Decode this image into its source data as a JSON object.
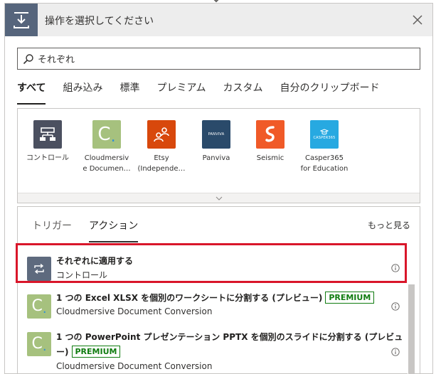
{
  "header": {
    "title": "操作を選択してください"
  },
  "search": {
    "value": "それぞれ"
  },
  "tabs": [
    {
      "label": "すべて",
      "active": true
    },
    {
      "label": "組み込み"
    },
    {
      "label": "標準"
    },
    {
      "label": "プレミアム"
    },
    {
      "label": "カスタム"
    },
    {
      "label": "自分のクリップボード"
    }
  ],
  "connectors": [
    {
      "label": "コントロール",
      "icon": "control-icon",
      "color": "#4b5060"
    },
    {
      "label": "Cloudmersive Documen…",
      "label_lines": [
        "Cloudmersiv",
        "e Documen…"
      ],
      "icon": "cloudmersive-icon",
      "color": "#a6c17e"
    },
    {
      "label": "Etsy (Independe…",
      "label_lines": [
        "Etsy",
        "(Independe…"
      ],
      "icon": "etsy-icon",
      "color": "#d8480c"
    },
    {
      "label": "Panviva",
      "icon": "panviva-icon",
      "color": "#2a4a6a",
      "tile_text": "PANVIVA"
    },
    {
      "label": "Seismic",
      "icon": "seismic-icon",
      "color": "#f05a28"
    },
    {
      "label": "Casper365 for Education",
      "label_lines": [
        "Casper365",
        "for Education"
      ],
      "icon": "casper-icon",
      "color": "#27a9e1",
      "tile_text": "CASPER365"
    }
  ],
  "subtabs": [
    {
      "label": "トリガー"
    },
    {
      "label": "アクション",
      "active": true
    }
  ],
  "see_more": "もっと見る",
  "actions": [
    {
      "title": "それぞれに適用する",
      "subtitle": "コントロール",
      "icon": "loop-icon",
      "color": "#5e6a7e"
    },
    {
      "title": "1 つの Excel XLSX を個別のワークシートに分割する (プレビュー)",
      "premium": "PREMIUM",
      "subtitle": "Cloudmersive Document Conversion",
      "icon": "cloudmersive-icon",
      "color": "#a6c17e"
    },
    {
      "title_line1": "1 つの PowerPoint プレゼンテーション PPTX を個別のスライドに分割する (プレビュ",
      "title_line2": "ー)",
      "premium": "PREMIUM",
      "subtitle": "Cloudmersive Document Conversion",
      "icon": "cloudmersive-icon",
      "color": "#a6c17e"
    }
  ],
  "colors": {
    "highlight": "#d9162a",
    "premium": "#107c10",
    "header_icon_bg": "#56657c"
  }
}
